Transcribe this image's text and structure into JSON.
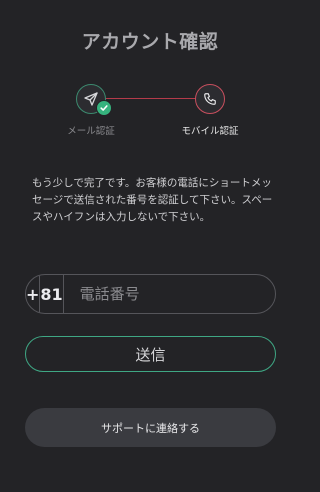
{
  "page": {
    "title": "アカウント確認"
  },
  "steps": [
    {
      "label": "メール認証",
      "state": "done",
      "icon": "send-icon"
    },
    {
      "label": "モバイル認証",
      "state": "active",
      "icon": "phone-icon"
    }
  ],
  "message": "もう少しで完了です。お客様の電話にショートメッセージで送信された番号を認証して下さい。スペースやハイフンは入力しないで下さい。",
  "phone": {
    "prefix": "+",
    "country_code": "81",
    "placeholder": "電話番号",
    "value": ""
  },
  "buttons": {
    "submit": "送信",
    "support": "サポートに連絡する"
  },
  "colors": {
    "background": "#232326",
    "done_accent": "#36b37e",
    "active_accent": "#c94f5e",
    "submit_border": "#3fa784"
  }
}
